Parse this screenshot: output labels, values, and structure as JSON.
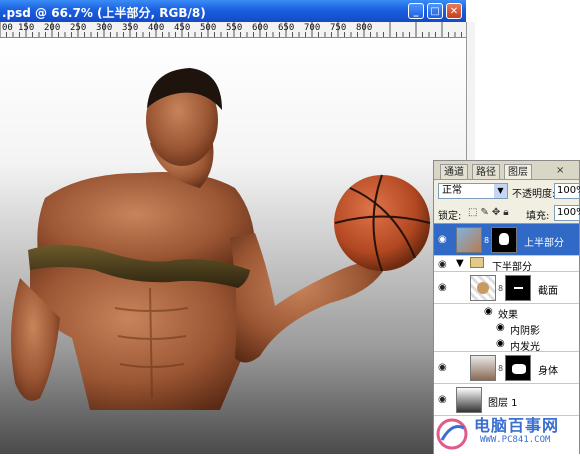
{
  "window": {
    "title": ".psd @ 66.7% (上半部分, RGB/8)",
    "buttons": {
      "minimize": "_",
      "maximize": "□",
      "close": "✕"
    }
  },
  "ruler": {
    "labels": [
      "00",
      "150",
      "200",
      "250",
      "300",
      "350",
      "400",
      "450",
      "500",
      "550",
      "600",
      "650",
      "700",
      "750",
      "800"
    ]
  },
  "panel": {
    "tabs": [
      "通道",
      "路径",
      "图层"
    ],
    "active_tab": "图层",
    "tab_close": "×",
    "blend_mode": "正常",
    "opacity_label": "不透明度:",
    "opacity_value": "100%",
    "lock_label": "锁定:",
    "fill_label": "填充:",
    "fill_value": "100%",
    "layers": [
      {
        "name": "上半部分",
        "selected": true
      },
      {
        "name": "下半部分",
        "type": "group"
      },
      {
        "name": "截面"
      },
      {
        "name": "效果"
      },
      {
        "name": "内阴影"
      },
      {
        "name": "内发光"
      },
      {
        "name": "身体"
      },
      {
        "name": "图层 1"
      }
    ]
  },
  "watermark": {
    "text": "电脑百事网",
    "url": "WWW.PC841.COM"
  },
  "colors": {
    "title_bar": "#1a60e0",
    "selected_layer": "#3169c6",
    "panel_bg": "#f1efe2"
  }
}
